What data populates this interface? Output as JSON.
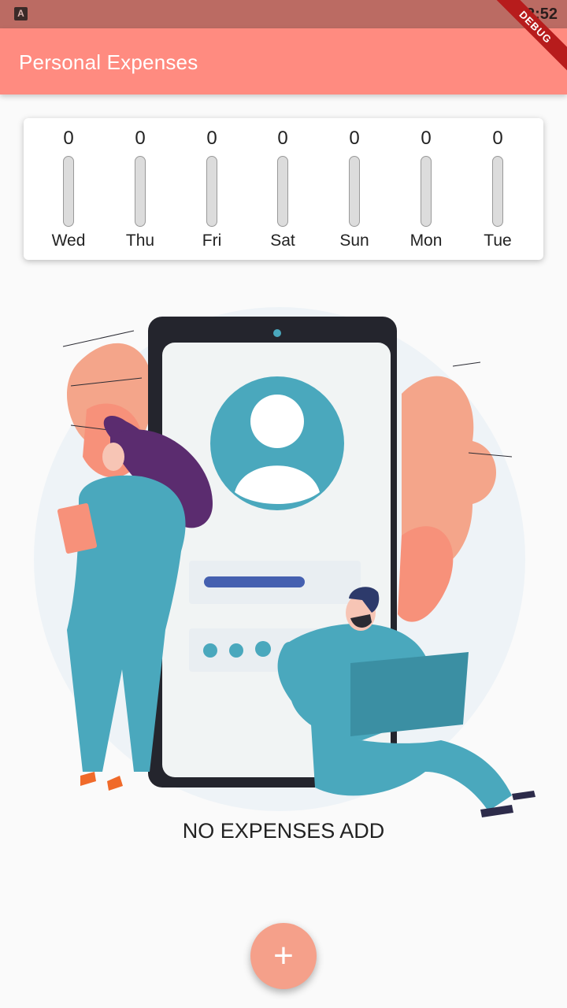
{
  "status_bar": {
    "time": "12:52",
    "app_icon_letter": "A"
  },
  "debug_banner": {
    "label": "DEBUG"
  },
  "app_bar": {
    "title": "Personal Expenses"
  },
  "chart": {
    "days": [
      {
        "label": "Wed",
        "amount": "0",
        "fill_fraction": 0
      },
      {
        "label": "Thu",
        "amount": "0",
        "fill_fraction": 0
      },
      {
        "label": "Fri",
        "amount": "0",
        "fill_fraction": 0
      },
      {
        "label": "Sat",
        "amount": "0",
        "fill_fraction": 0
      },
      {
        "label": "Sun",
        "amount": "0",
        "fill_fraction": 0
      },
      {
        "label": "Mon",
        "amount": "0",
        "fill_fraction": 0
      },
      {
        "label": "Tue",
        "amount": "0",
        "fill_fraction": 0
      }
    ]
  },
  "empty_state": {
    "message": "NO EXPENSES ADD",
    "illustration": "people-with-phone-illustration"
  },
  "fab": {
    "icon": "plus-icon",
    "symbol": "+"
  },
  "colors": {
    "primary": "#ff8b80",
    "accent": "#f5a08a",
    "teal": "#4aa8bd"
  }
}
